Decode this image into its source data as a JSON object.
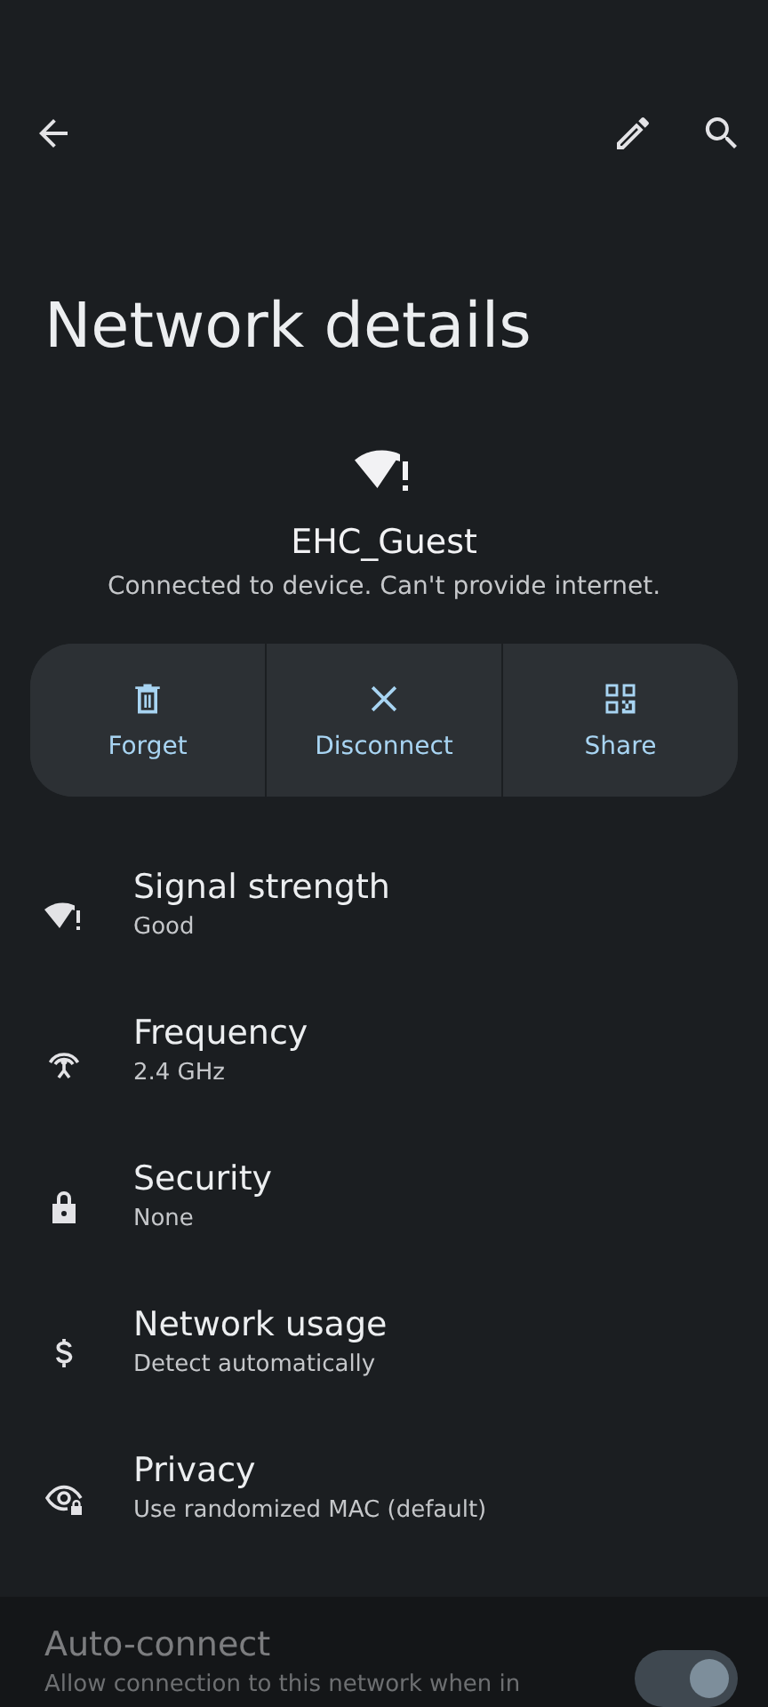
{
  "title": "Network details",
  "network": {
    "name": "EHC_Guest",
    "status": "Connected to device. Can't provide internet."
  },
  "actions": [
    {
      "label": "Forget"
    },
    {
      "label": "Disconnect"
    },
    {
      "label": "Share"
    }
  ],
  "details": [
    {
      "title": "Signal strength",
      "value": "Good"
    },
    {
      "title": "Frequency",
      "value": "2.4 GHz"
    },
    {
      "title": "Security",
      "value": "None"
    },
    {
      "title": "Network usage",
      "value": "Detect automatically"
    },
    {
      "title": "Privacy",
      "value": "Use randomized MAC (default)"
    }
  ],
  "auto_connect": {
    "title": "Auto-connect",
    "description": "Allow connection to this network when in",
    "disabled": true,
    "on": true
  }
}
